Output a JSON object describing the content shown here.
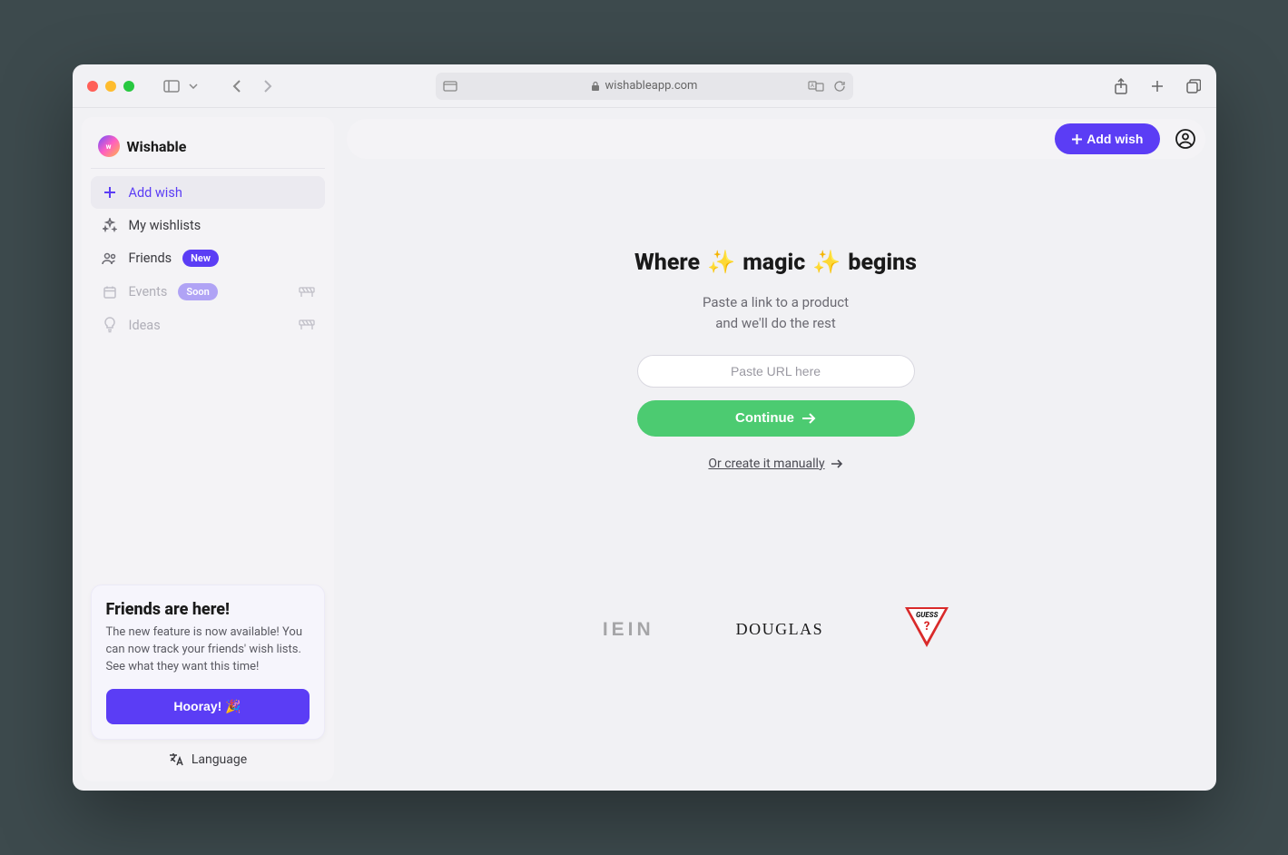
{
  "browser": {
    "url": "wishableapp.com"
  },
  "sidebar": {
    "brand": "Wishable",
    "nav": [
      {
        "label": "Add wish"
      },
      {
        "label": "My wishlists"
      },
      {
        "label": "Friends",
        "badge": "New"
      },
      {
        "label": "Events",
        "badge": "Soon"
      },
      {
        "label": "Ideas"
      }
    ],
    "promo": {
      "title": "Friends are here!",
      "body": "The new feature is now available! You can now track your friends' wish lists. See what they want this time!",
      "cta": "Hooray! 🎉"
    },
    "language": "Language"
  },
  "topbar": {
    "add_wish": "Add wish"
  },
  "hero": {
    "title_pre": "Where",
    "title_mid": "magic",
    "title_post": "begins",
    "subtitle_line1": "Paste a link to a product",
    "subtitle_line2": "and we'll do the rest",
    "placeholder": "Paste URL here",
    "continue": "Continue",
    "manual": "Or create it manually "
  },
  "brands": {
    "b1": "IEIN",
    "b2": "DOUGLAS",
    "b3_name": "GUESS",
    "b3_mark": "?"
  }
}
